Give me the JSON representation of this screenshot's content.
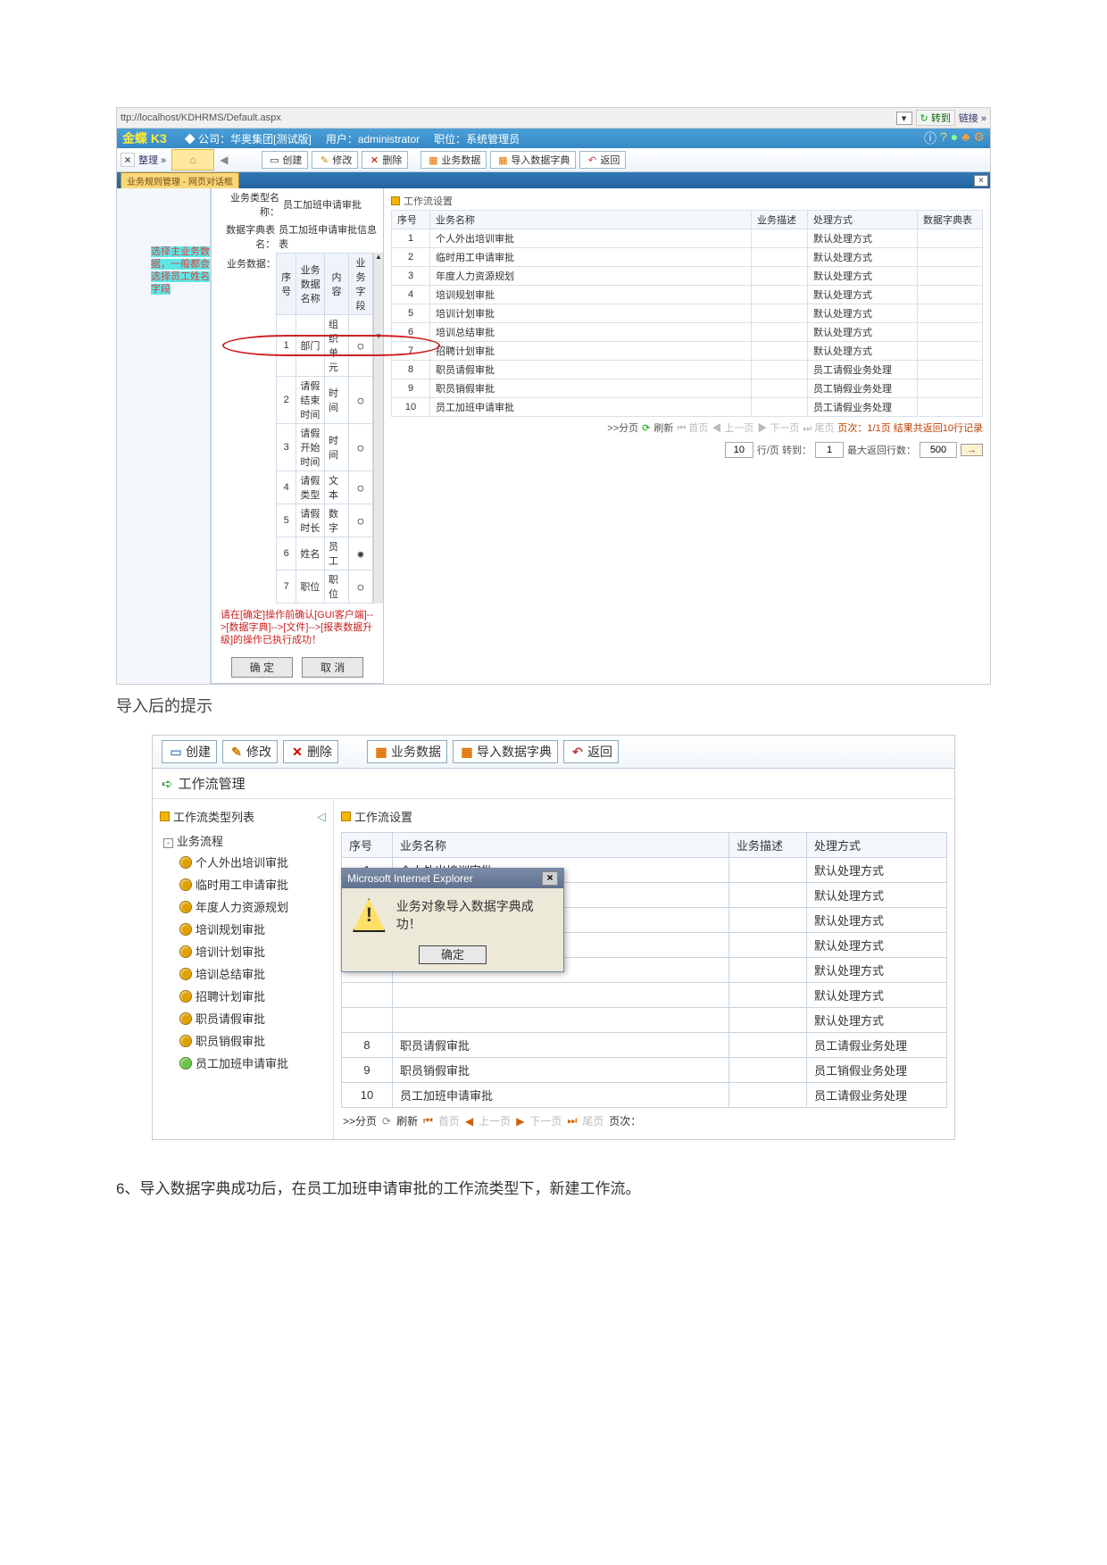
{
  "screenshot1": {
    "addressbar": {
      "url": "ttp://localhost/KDHRMS/Default.aspx",
      "go": "转到",
      "links": "链接 »"
    },
    "header": {
      "logo": "金蝶 K3",
      "company": "◆ 公司：华奥集团[测试版]",
      "user": "用户：administrator",
      "role": "职位：系统管理员"
    },
    "toolbar": {
      "expand": "整理 »",
      "create": "创建",
      "modify": "修改",
      "delete": "删除",
      "bizdata": "业务数据",
      "importdict": "导入数据字典",
      "back": "返回"
    },
    "tab": {
      "name": "业务规则管理 - 网页对话框"
    },
    "form": {
      "label1": "业务类型名称：",
      "val1": "员工加班申请审批",
      "label2": "数据字典表名：",
      "val2": "员工加班申请审批信息表",
      "label3": "业务数据：",
      "hint1": "选择主业务数据，一般都会选择员工姓名字段",
      "cols": [
        "序号",
        "业务数据名称",
        "内容",
        "业务字段"
      ],
      "rows": [
        {
          "n": "1",
          "name": "部门",
          "type": "组织单元",
          "sel": "○"
        },
        {
          "n": "2",
          "name": "请假结束时间",
          "type": "时间",
          "sel": "○"
        },
        {
          "n": "3",
          "name": "请假开始时间",
          "type": "时间",
          "sel": "○"
        },
        {
          "n": "4",
          "name": "请假类型",
          "type": "文本",
          "sel": "○"
        },
        {
          "n": "5",
          "name": "请假时长",
          "type": "数字",
          "sel": "○"
        },
        {
          "n": "6",
          "name": "姓名",
          "type": "员工",
          "sel": "●"
        },
        {
          "n": "7",
          "name": "职位",
          "type": "职位",
          "sel": "○"
        }
      ],
      "warn": "请在[确定]操作前确认[GUI客户端]-->[数据字典]-->[文件]-->[报表数据升级]的操作已执行成功！",
      "ok": "确 定",
      "cancel": "取 消"
    },
    "right": {
      "title": "工作流设置",
      "cols": [
        "序号",
        "业务名称",
        "业务描述",
        "处理方式",
        "数据字典表"
      ],
      "rows": [
        {
          "n": "1",
          "name": "个人外出培训审批",
          "mode": "默认处理方式"
        },
        {
          "n": "2",
          "name": "临时用工申请审批",
          "mode": "默认处理方式"
        },
        {
          "n": "3",
          "name": "年度人力资源规划",
          "mode": "默认处理方式"
        },
        {
          "n": "4",
          "name": "培训规划审批",
          "mode": "默认处理方式"
        },
        {
          "n": "5",
          "name": "培训计划审批",
          "mode": "默认处理方式"
        },
        {
          "n": "6",
          "name": "培训总结审批",
          "mode": "默认处理方式"
        },
        {
          "n": "7",
          "name": "招聘计划审批",
          "mode": "默认处理方式"
        },
        {
          "n": "8",
          "name": "职员请假审批",
          "mode": "员工请假业务处理"
        },
        {
          "n": "9",
          "name": "职员销假审批",
          "mode": "员工销假业务处理"
        },
        {
          "n": "10",
          "name": "员工加班申请审批",
          "mode": "员工请假业务处理"
        }
      ],
      "pager": {
        "split": ">>分页",
        "refresh": "刷新",
        "first": "首页",
        "prev": "上一页",
        "next": "下一页",
        "last": "尾页",
        "info": "页次：1/1页  结果共返回10行记录",
        "perpage_prefix": "",
        "perpage_val": "10",
        "perpage_suffix": " 行/页 转到：",
        "goto_val": "1",
        "max_label": "最大返回行数：",
        "max_val": "500",
        "gobtn": "→"
      }
    }
  },
  "caption1": "导入后的提示",
  "screenshot2": {
    "toolbar": {
      "create": "创建",
      "modify": "修改",
      "delete": "删除",
      "bizdata": "业务数据",
      "importdict": "导入数据字典",
      "back": "返回"
    },
    "subheader": "工作流管理",
    "tree": {
      "title": "工作流类型列表",
      "root": "业务流程",
      "items": [
        {
          "label": "个人外出培训审批"
        },
        {
          "label": "临时用工申请审批"
        },
        {
          "label": "年度人力资源规划"
        },
        {
          "label": "培训规划审批"
        },
        {
          "label": "培训计划审批"
        },
        {
          "label": "培训总结审批"
        },
        {
          "label": "招聘计划审批"
        },
        {
          "label": "职员请假审批"
        },
        {
          "label": "职员销假审批"
        },
        {
          "label": "员工加班申请审批",
          "green": true
        }
      ]
    },
    "grid": {
      "title": "工作流设置",
      "cols": [
        "序号",
        "业务名称",
        "业务描述",
        "处理方式"
      ],
      "rows": [
        {
          "n": "1",
          "name": "个人外出培训审批",
          "mode": "默认处理方式"
        },
        {
          "n": "",
          "name": "",
          "mode": "默认处理方式"
        },
        {
          "n": "",
          "name": "",
          "mode": "默认处理方式"
        },
        {
          "n": "",
          "name": "",
          "mode": "默认处理方式"
        },
        {
          "n": "",
          "name": "",
          "mode": "默认处理方式"
        },
        {
          "n": "",
          "name": "",
          "mode": "默认处理方式"
        },
        {
          "n": "",
          "name": "",
          "mode": "默认处理方式"
        },
        {
          "n": "8",
          "name": "职员请假审批",
          "mode": "员工请假业务处理"
        },
        {
          "n": "9",
          "name": "职员销假审批",
          "mode": "员工销假业务处理"
        },
        {
          "n": "10",
          "name": "员工加班申请审批",
          "mode": "员工请假业务处理"
        }
      ]
    },
    "dialog": {
      "title": "Microsoft Internet Explorer",
      "msg": "业务对象导入数据字典成功！",
      "ok": "确定"
    },
    "pager": {
      "split": ">>分页",
      "refresh": "刷新",
      "first": "首页",
      "prev": "上一页",
      "next": "下一页",
      "last": "尾页",
      "info": "页次："
    }
  },
  "footer": "6、导入数据字典成功后，在员工加班申请审批的工作流类型下，新建工作流。"
}
